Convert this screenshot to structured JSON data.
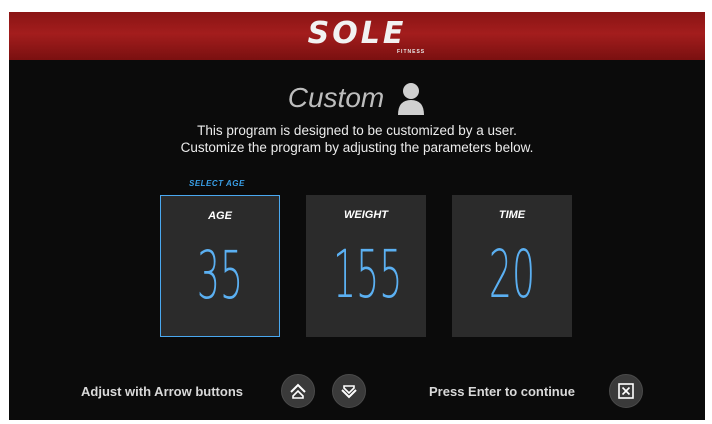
{
  "header": {
    "brand": "SOLE",
    "brand_sub": "FITNESS"
  },
  "program": {
    "title": "Custom",
    "icon": "user-silhouette-icon"
  },
  "description": {
    "line1": "This program is designed to be customized by a user.",
    "line2": "Customize the program by adjusting the parameters below."
  },
  "selection_hint": "SELECT AGE",
  "parameters": [
    {
      "label": "AGE",
      "value": "35",
      "selected": true
    },
    {
      "label": "WEIGHT",
      "value": "155",
      "selected": false
    },
    {
      "label": "TIME",
      "value": "20",
      "selected": false
    }
  ],
  "footer": {
    "adjust_label": "Adjust with Arrow buttons",
    "enter_label": "Press Enter to continue"
  },
  "colors": {
    "header_red": "#a31d1d",
    "accent_blue": "#4aa8f0",
    "tile_bg": "#2b2b2b"
  }
}
